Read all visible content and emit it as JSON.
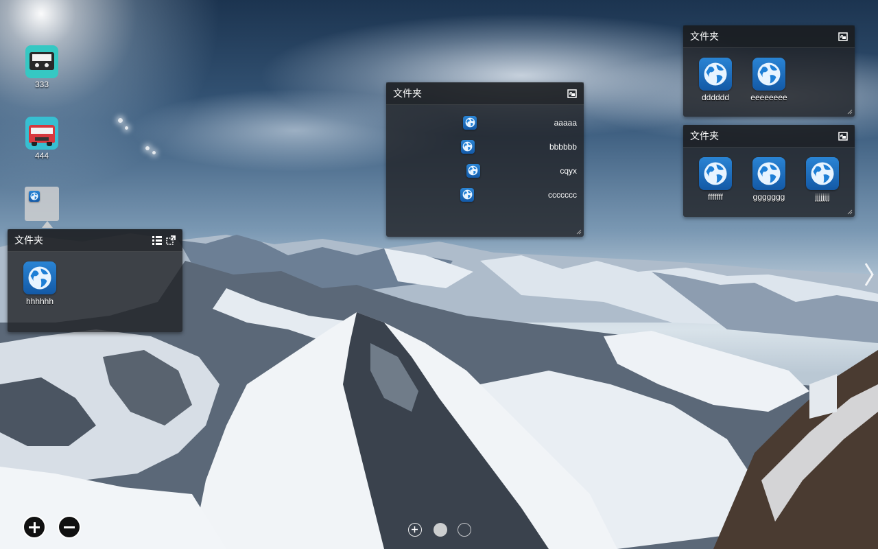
{
  "desktop_icons": [
    {
      "label": "333",
      "icon": "cassette-icon"
    },
    {
      "label": "444",
      "icon": "bus-icon"
    }
  ],
  "panels": {
    "left": {
      "title": "文件夹",
      "apps": [
        {
          "name": "hhhhhh",
          "icon": "globe-icon"
        }
      ]
    },
    "middle": {
      "title": "文件夹",
      "items": [
        {
          "name": "aaaaa",
          "icon": "globe-icon"
        },
        {
          "name": "bbbbbb",
          "icon": "globe-icon"
        },
        {
          "name": "cqyx",
          "icon": "globe-icon"
        },
        {
          "name": "ccccccc",
          "icon": "globe-icon"
        }
      ]
    },
    "right_top": {
      "title": "文件夹",
      "apps": [
        {
          "name": "dddddd",
          "icon": "globe-icon"
        },
        {
          "name": "eeeeeeee",
          "icon": "globe-icon"
        }
      ]
    },
    "right_bottom": {
      "title": "文件夹",
      "apps": [
        {
          "name": "fffffff",
          "icon": "globe-icon"
        },
        {
          "name": "ggggggg",
          "icon": "globe-icon"
        },
        {
          "name": "jjjjjjjj",
          "icon": "globe-icon"
        }
      ]
    }
  },
  "controls": {
    "add": "add-icon",
    "remove": "remove-icon",
    "pages": 3,
    "current_page": 2
  },
  "colors": {
    "panel_bg": "#202226",
    "icon_blue": "#1a6fc0"
  }
}
